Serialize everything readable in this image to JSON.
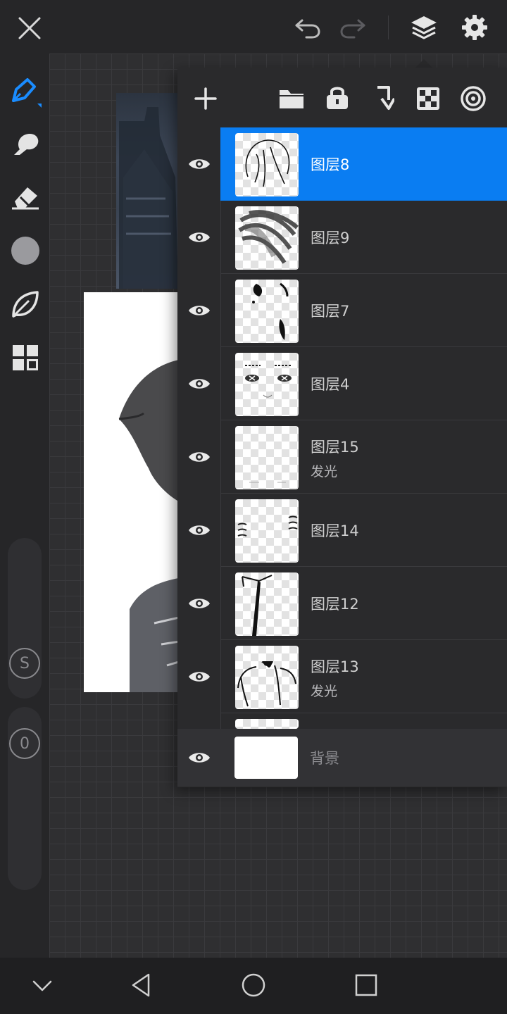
{
  "topbar": {
    "close_icon": "close-icon",
    "undo_icon": "undo-icon",
    "redo_icon": "redo-icon",
    "layers_icon": "layers-icon",
    "settings_icon": "gear-icon"
  },
  "left_toolbar": {
    "tools": [
      "pen-icon",
      "smudge-icon",
      "eraser-icon",
      "color-icon",
      "leaf-icon",
      "gallery-icon"
    ],
    "accent_color": "#1a8cff",
    "size_slider_label": "S",
    "opacity_slider_label": "0"
  },
  "layers_panel": {
    "toolbar": [
      "add-layer",
      "folder",
      "lock",
      "merge-down",
      "alpha-lock",
      "clipping"
    ],
    "layers": [
      {
        "name": "图层8",
        "blend": "",
        "selected": true
      },
      {
        "name": "图层9",
        "blend": "",
        "selected": false
      },
      {
        "name": "图层7",
        "blend": "",
        "selected": false
      },
      {
        "name": "图层4",
        "blend": "",
        "selected": false
      },
      {
        "name": "图层15",
        "blend": "发光",
        "selected": false
      },
      {
        "name": "图层14",
        "blend": "",
        "selected": false
      },
      {
        "name": "图层12",
        "blend": "",
        "selected": false
      },
      {
        "name": "图层13",
        "blend": "发光",
        "selected": false
      }
    ],
    "background_layer": {
      "name": "背景"
    },
    "selected_color": "#0a7df2"
  },
  "navbar": {
    "buttons": [
      "chevron-down-icon",
      "back-icon",
      "home-icon",
      "recents-icon"
    ]
  }
}
